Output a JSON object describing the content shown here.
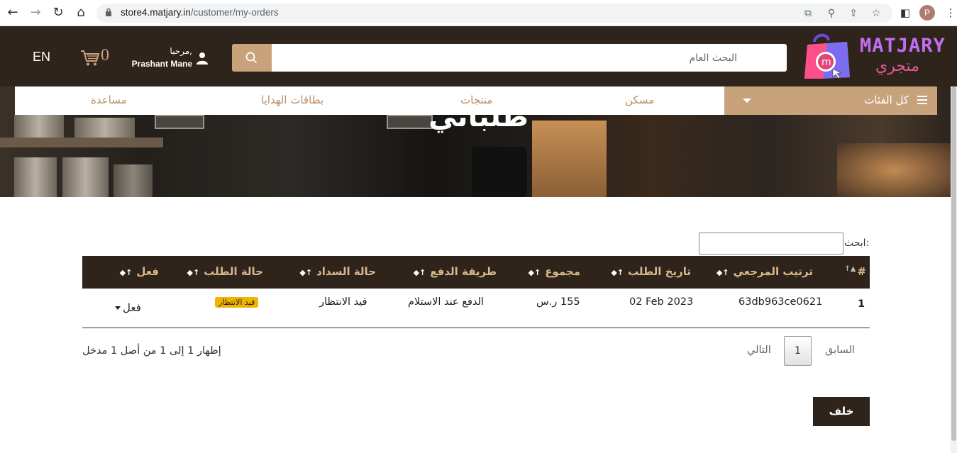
{
  "browser": {
    "url_host": "store4.matjary.in",
    "url_path": "/customer/my-orders",
    "profile_initial": "P"
  },
  "header": {
    "brand_en": "MATJARY",
    "brand_ar": "متجري",
    "search_placeholder": "البحث العام",
    "greeting": "مرحبا,",
    "user_name": "Prashant Mane",
    "cart_count": "0",
    "lang": "EN"
  },
  "nav": {
    "all_categories": "كل الفئات",
    "links": [
      "مسكن",
      "منتجات",
      "بطاقات الهدايا",
      "مساعدة"
    ]
  },
  "hero": {
    "title": "طلباتي"
  },
  "orders": {
    "filter_label": "ابحث:",
    "columns": [
      "#",
      "ترتيب المرجعي",
      "تاريخ الطلب",
      "مجموع",
      "طريقة الدفع",
      "حالة السداد",
      "حالة الطلب",
      "فعل"
    ],
    "rows": [
      {
        "index": "1",
        "ref": "63db963ce0621",
        "date": "02 Feb 2023",
        "total": "155 ر.س",
        "payment_method": "الدفع عند الاستلام",
        "payment_status": "قيد الانتظار",
        "order_status": "قيد الانتظار",
        "action": "فعل"
      }
    ],
    "info": "إظهار 1 إلى 1 من أصل 1 مدخل",
    "pager_prev": "السابق",
    "pager_page": "1",
    "pager_next": "التالي",
    "back_label": "خلف"
  },
  "colors": {
    "header_bg": "#2e241b",
    "accent": "#c8a27a",
    "badge": "#f0b400"
  }
}
